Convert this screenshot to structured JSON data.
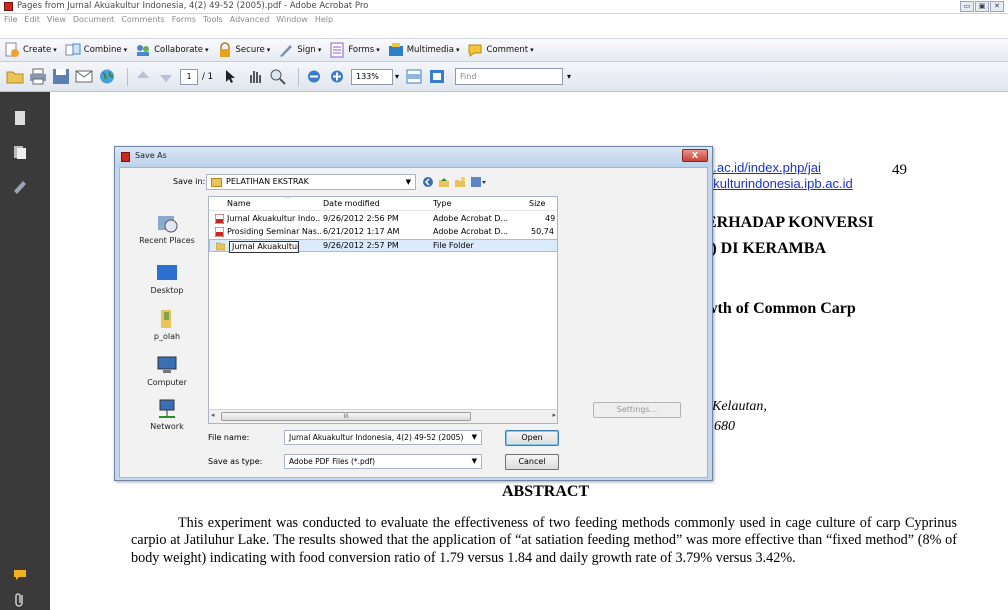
{
  "window": {
    "title": "Pages from Jurnal Akuakultur Indonesia, 4(2) 49-52 (2005).pdf - Adobe Acrobat Pro",
    "controls": [
      "▭",
      "▣",
      "✕"
    ]
  },
  "menubar": [
    "File",
    "Edit",
    "View",
    "Document",
    "Comments",
    "Forms",
    "Tools",
    "Advanced",
    "Window",
    "Help"
  ],
  "tasks_toolbar": [
    {
      "label": "Create",
      "icon": "create-icon",
      "color": "#f0a030"
    },
    {
      "label": "Combine",
      "icon": "combine-icon",
      "color": "#3b8bd6"
    },
    {
      "label": "Collaborate",
      "icon": "collaborate-icon",
      "color": "#4a86c9"
    },
    {
      "label": "Secure",
      "icon": "lock-icon",
      "color": "#e6a21c"
    },
    {
      "label": "Sign",
      "icon": "pen-icon",
      "color": "#7b8fb0"
    },
    {
      "label": "Forms",
      "icon": "forms-icon",
      "color": "#8a5fc9"
    },
    {
      "label": "Multimedia",
      "icon": "multimedia-icon",
      "color": "#2f7fc7"
    },
    {
      "label": "Comment",
      "icon": "comment-icon",
      "color": "#f3c53a"
    }
  ],
  "nav_toolbar": {
    "page_current": "1",
    "page_total": "/ 1",
    "zoom": "133%",
    "find_placeholder": "Find"
  },
  "document": {
    "page_number": "49",
    "url_line1": "b.ac.id/index.php/jai",
    "url_line2": "akulturindonesia.ipb.ac.id",
    "title_line1": "ERHADAP KONVERSI",
    "title_line2": "fo) DI KERAMBA",
    "english_title": "wth of Common Carp",
    "affiliation1": "Kelautan,",
    "affiliation2": "680",
    "abstract_heading": "ABSTRACT",
    "abstract_text": "This experiment was conducted to evaluate the effectiveness of two feeding methods commonly used in cage culture of carp Cyprinus carpio at Jatiluhur Lake. The results showed that the application of “at satiation feeding method” was more effective than “fixed method” (8% of body weight) indicating with food conversion ratio of 1.79 versus 1.84 and daily growth rate of 3.79% versus 3.42%."
  },
  "dialog": {
    "title": "Save As",
    "save_in_label": "Save in:",
    "save_in_value": "PELATIHAN EKSTRAK",
    "places": [
      "Recent Places",
      "Desktop",
      "p_olah",
      "Computer",
      "Network"
    ],
    "columns": [
      "Name",
      "Date modified",
      "Type",
      "Size"
    ],
    "files": [
      {
        "name": "Jurnal Akuakultur Indo...",
        "date": "9/26/2012 2:56 PM",
        "type": "Adobe Acrobat D...",
        "size": "49",
        "kind": "pdf"
      },
      {
        "name": "Prosiding Seminar Nas...",
        "date": "6/21/2012 1:17 AM",
        "type": "Adobe Acrobat D...",
        "size": "50,74",
        "kind": "pdf"
      },
      {
        "name": "Jurnal Akuakultur",
        "date": "9/26/2012 2:57 PM",
        "type": "File Folder",
        "size": "",
        "kind": "folder"
      }
    ],
    "scroll_grip": "III",
    "settings_label": "Settings...",
    "file_name_label": "File name:",
    "file_name_value": "Jurnal Akuakultur Indonesia, 4(2) 49-52 (2005)",
    "save_type_label": "Save as type:",
    "save_type_value": "Adobe PDF Files (*.pdf)",
    "open_label": "Open",
    "cancel_label": "Cancel",
    "close_glyph": "X"
  }
}
